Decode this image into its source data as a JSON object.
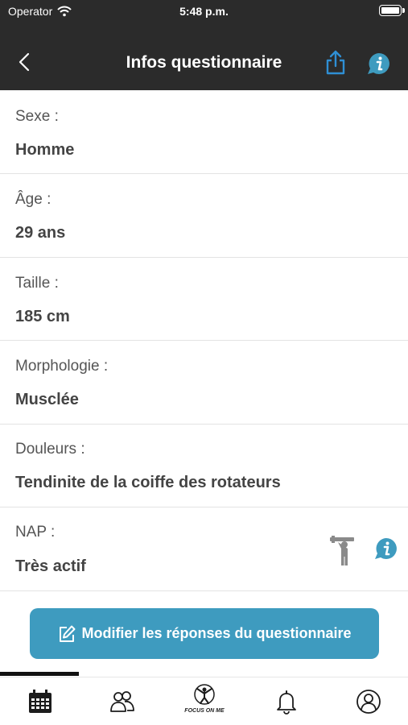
{
  "status_bar": {
    "carrier": "Operator",
    "time": "5:48 p.m."
  },
  "nav": {
    "title": "Infos questionnaire",
    "back_icon": "chevron-left-icon",
    "share_icon": "share-icon",
    "info_icon": "info-bubble-icon"
  },
  "fields": [
    {
      "label": "Sexe :",
      "value": "Homme"
    },
    {
      "label": "Âge :",
      "value": "29 ans"
    },
    {
      "label": "Taille :",
      "value": "185 cm"
    },
    {
      "label": "Morphologie :",
      "value": "Musclée"
    },
    {
      "label": "Douleurs :",
      "value": "Tendinite de la coiffe des rotateurs"
    },
    {
      "label": "NAP :",
      "value": "Très actif",
      "icons": [
        "worker-carrying-icon",
        "info-bubble-icon"
      ]
    }
  ],
  "edit_button": {
    "label": "Modifier les réponses du questionnaire",
    "icon": "edit-icon"
  },
  "tab_bar": {
    "items": [
      {
        "name": "calendar",
        "icon": "calendar-icon",
        "active": true
      },
      {
        "name": "users",
        "icon": "group-icon"
      },
      {
        "name": "focus-on-me",
        "icon": "focus-on-me-logo",
        "text": "FOCUS ON ME"
      },
      {
        "name": "notifications",
        "icon": "bell-icon"
      },
      {
        "name": "profile",
        "icon": "user-circle-icon"
      }
    ]
  },
  "colors": {
    "header_bg": "#2b2b2b",
    "accent": "#3e9bbf",
    "share_blue": "#2f8fd4"
  }
}
